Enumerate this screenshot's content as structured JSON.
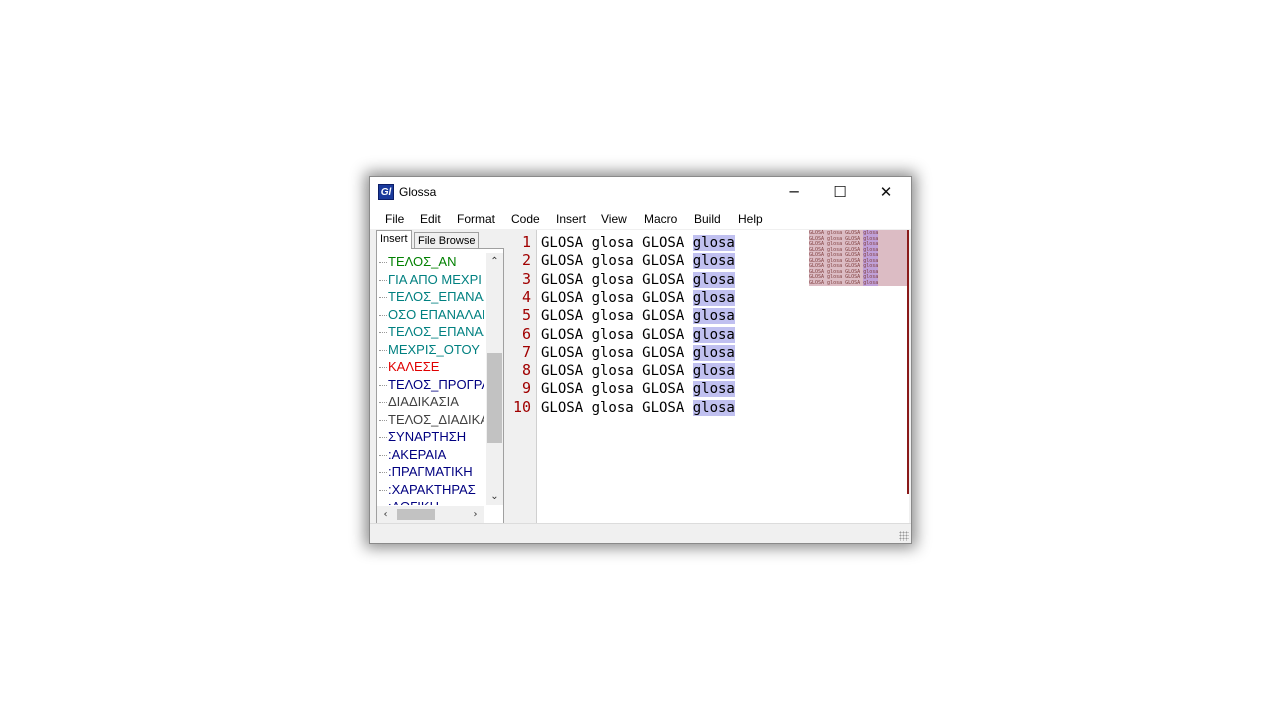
{
  "window": {
    "title": "Glossa",
    "icon": "Gl"
  },
  "title_buttons": {
    "minimize": "─",
    "maximize": "☐",
    "close": "✕"
  },
  "menu": [
    "File",
    "Edit",
    "Format",
    "Code",
    "Insert",
    "View",
    "Macro",
    "Build",
    "Help"
  ],
  "left_tabs": [
    "Insert",
    "File Browse"
  ],
  "tree": [
    {
      "label": "ΤΕΛΟΣ_ΑΝ",
      "color": "#008000"
    },
    {
      "label": "ΓΙΑ ΑΠΟ ΜΕΧΡΙ",
      "color": "#008080"
    },
    {
      "label": " ΤΕΛΟΣ_ΕΠΑΝΑΛΗΨΗΣ",
      "color": "#008080"
    },
    {
      "label": " ΟΣΟ ΕΠΑΝΑΛΑΒΕ",
      "color": "#008080"
    },
    {
      "label": "ΤΕΛΟΣ_ΕΠΑΝΑΛΗΨΗΣ",
      "color": "#008080"
    },
    {
      "label": "ΜΕΧΡΙΣ_ΟΤΟΥ",
      "color": "#008080"
    },
    {
      "label": " ΚΑΛΕΣΕ",
      "color": "#e00000"
    },
    {
      "label": "ΤΕΛΟΣ_ΠΡΟΓΡΑΜΜΑΤΟΣ",
      "color": "#000080"
    },
    {
      "label": "ΔΙΑΔΙΚΑΣΙΑ",
      "color": "#404040"
    },
    {
      "label": "ΤΕΛΟΣ_ΔΙΑΔΙΚΑΣΙΑΣ",
      "color": "#404040"
    },
    {
      "label": "ΣΥΝΑΡΤΗΣΗ",
      "color": "#000080"
    },
    {
      "label": " :ΑΚΕΡΑΙΑ",
      "color": "#000080"
    },
    {
      "label": " :ΠΡΑΓΜΑΤΙΚΗ",
      "color": "#000080"
    },
    {
      "label": " :ΧΑΡΑΚΤΗΡΑΣ",
      "color": "#000080"
    },
    {
      "label": " :ΛΟΓΙΚΗ",
      "color": "#000080"
    }
  ],
  "scroll_arrows": {
    "up": "⌃",
    "down": "⌄",
    "left": "‹",
    "right": "›"
  },
  "code_lines": [
    {
      "num": "1",
      "text": "GLOSA glosa GLOSA ",
      "selected": "glosa"
    },
    {
      "num": "2",
      "text": "GLOSA glosa GLOSA ",
      "selected": "glosa"
    },
    {
      "num": "3",
      "text": "GLOSA glosa GLOSA ",
      "selected": "glosa"
    },
    {
      "num": "4",
      "text": "GLOSA glosa GLOSA ",
      "selected": "glosa"
    },
    {
      "num": "5",
      "text": "GLOSA glosa GLOSA ",
      "selected": "glosa"
    },
    {
      "num": "6",
      "text": "GLOSA glosa GLOSA ",
      "selected": "glosa"
    },
    {
      "num": "7",
      "text": "GLOSA glosa GLOSA ",
      "selected": "glosa"
    },
    {
      "num": "8",
      "text": "GLOSA glosa GLOSA ",
      "selected": "glosa"
    },
    {
      "num": "9",
      "text": "GLOSA glosa GLOSA ",
      "selected": "glosa"
    },
    {
      "num": "10",
      "text": "GLOSA glosa GLOSA ",
      "selected": "glosa"
    }
  ],
  "colors": {
    "line_numbers": "#a00000",
    "selection": "#c0c0f0",
    "minimap_bg": "#dcbcc4"
  }
}
